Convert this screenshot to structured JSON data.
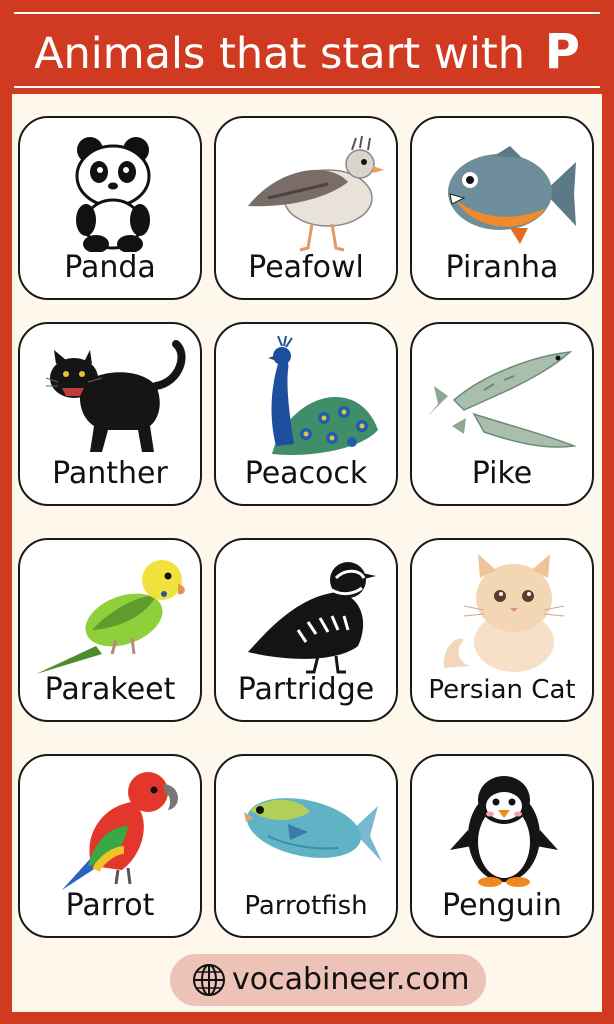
{
  "header": {
    "title": "Animals that start with",
    "letter": "P"
  },
  "cards": [
    {
      "name": "Panda",
      "icon": "panda-icon"
    },
    {
      "name": "Peafowl",
      "icon": "peafowl-icon"
    },
    {
      "name": "Piranha",
      "icon": "piranha-icon"
    },
    {
      "name": "Panther",
      "icon": "panther-icon"
    },
    {
      "name": "Peacock",
      "icon": "peacock-icon"
    },
    {
      "name": "Pike",
      "icon": "pike-icon"
    },
    {
      "name": "Parakeet",
      "icon": "parakeet-icon"
    },
    {
      "name": "Partridge",
      "icon": "partridge-icon"
    },
    {
      "name": "Persian Cat",
      "icon": "persian-cat-icon"
    },
    {
      "name": "Parrot",
      "icon": "parrot-icon"
    },
    {
      "name": "Parrotfish",
      "icon": "parrotfish-icon"
    },
    {
      "name": "Penguin",
      "icon": "penguin-icon"
    }
  ],
  "footer": {
    "site": "vocabineer.com",
    "icon": "globe-icon"
  },
  "colors": {
    "frame": "#cf3a20",
    "background": "#fdf7ec",
    "footer_pill": "#eec3b7"
  }
}
